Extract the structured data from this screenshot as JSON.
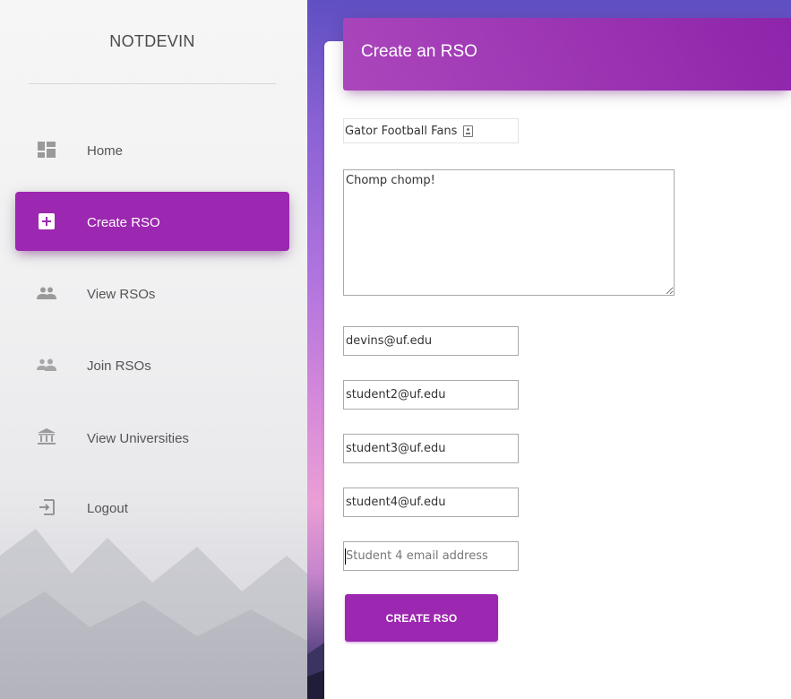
{
  "brand": "NOTDEVIN",
  "nav": [
    {
      "label": "Home",
      "icon": "dashboard-icon",
      "active": false
    },
    {
      "label": "Create RSO",
      "icon": "add-box-icon",
      "active": true
    },
    {
      "label": "View RSOs",
      "icon": "people-icon",
      "active": false
    },
    {
      "label": "Join RSOs",
      "icon": "group-add-icon",
      "active": false
    },
    {
      "label": "View Universities",
      "icon": "institution-icon",
      "active": false
    },
    {
      "label": "Logout",
      "icon": "logout-icon",
      "active": false
    }
  ],
  "card": {
    "title": "Create an RSO"
  },
  "form": {
    "name_value": "Gator Football Fans",
    "description_value": "Chomp chomp!",
    "emails": [
      {
        "value": "devins@uf.edu",
        "placeholder": ""
      },
      {
        "value": "student2@uf.edu",
        "placeholder": ""
      },
      {
        "value": "student3@uf.edu",
        "placeholder": ""
      },
      {
        "value": "student4@uf.edu",
        "placeholder": ""
      },
      {
        "value": "",
        "placeholder": "Student 4 email address"
      }
    ],
    "submit_label": "CREATE RSO"
  },
  "colors": {
    "accent": "#9c27b0",
    "header_gradient_start": "#ab47bc",
    "header_gradient_end": "#8e24aa"
  }
}
